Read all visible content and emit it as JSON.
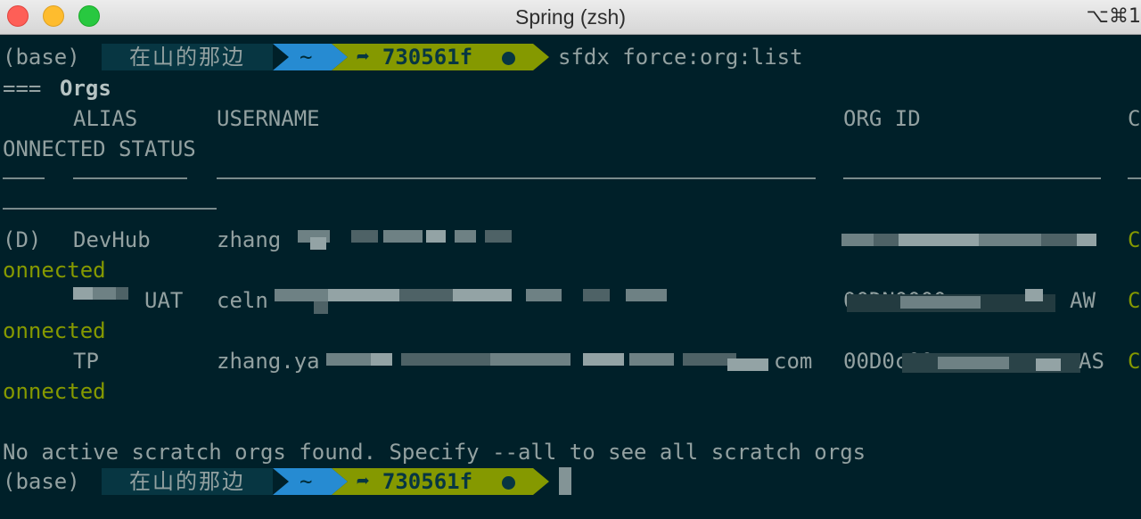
{
  "window": {
    "title": "Spring (zsh)",
    "shortcut": "⌥⌘1"
  },
  "prompt": {
    "env": "(base)",
    "host": "在山的那边",
    "dir": "~",
    "branch": "➦ 730561f",
    "colors": {
      "host_bg": "#073642",
      "dir_bg": "#268bd2",
      "git_bg": "#859900"
    }
  },
  "command": "sfdx force:org:list",
  "output": {
    "heading_prefix": "===",
    "heading": "Orgs",
    "columns": {
      "alias": "ALIAS",
      "username": "USERNAME",
      "org_id": "ORG ID",
      "connected_cut": "C",
      "connected_rest": "ONNECTED STATUS"
    },
    "rows": [
      {
        "default_marker": "(D)",
        "alias": "DevHub",
        "username_visible": "zhang",
        "org_id_visible": "",
        "status_cut": "C",
        "status_rest": "onnected"
      },
      {
        "default_marker": "",
        "alias": "UAT",
        "username_visible": "celn",
        "org_id_visible": "00DN0000",
        "org_id_tail": "AW",
        "status_cut": "C",
        "status_rest": "onnected"
      },
      {
        "default_marker": "",
        "alias": "TP",
        "username_visible": "zhang.ya",
        "username_tail": "com",
        "org_id_visible": "00D0c00",
        "org_id_tail": "AS",
        "status_cut": "C",
        "status_rest": "onnected"
      }
    ],
    "scratch_message": "No active scratch orgs found. Specify --all to see all scratch orgs"
  }
}
